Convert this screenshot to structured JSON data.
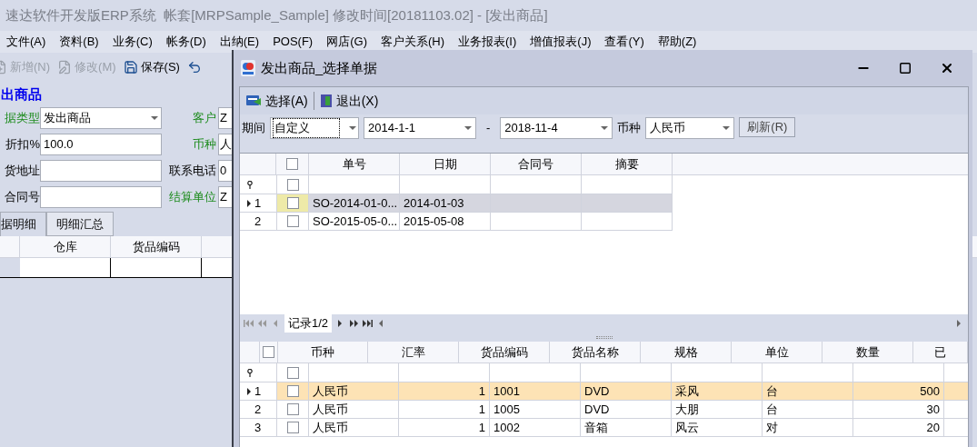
{
  "main_window": {
    "title": "速达软件开发版ERP系统  帐套[MRPSample_Sample] 修改时间[20181103.02] - [发出商品]",
    "menu": [
      "文件(A)",
      "资料(B)",
      "业务(C)",
      "帐务(D)",
      "出纳(E)",
      "POS(F)",
      "网店(G)",
      "客户关系(H)",
      "业务报表(I)",
      "增值报表(J)",
      "查看(Y)",
      "帮助(Z)"
    ],
    "toolbar": [
      {
        "kind": "new",
        "label": "新增(N)",
        "disabled": true
      },
      {
        "kind": "edit",
        "label": "修改(M)",
        "disabled": true
      },
      {
        "kind": "save",
        "label": "保存(S)",
        "disabled": false
      },
      {
        "kind": "undo",
        "disabled": false
      }
    ],
    "form_title": "出商品",
    "left_fields": [
      {
        "label": "据类型",
        "value": "发出商品",
        "required": true,
        "kind": "dropdown"
      },
      {
        "label": "折扣%",
        "value": "100.0",
        "required": false,
        "kind": "text"
      },
      {
        "label": "货地址",
        "required": false,
        "kind": "text"
      },
      {
        "label": "合同号",
        "required": false,
        "kind": "text"
      }
    ],
    "right_fields": [
      {
        "label": "客户",
        "value": "Z",
        "required": true
      },
      {
        "label": "币种",
        "value": "人",
        "required": true
      },
      {
        "label": "联系电话",
        "value": "0",
        "required": false
      },
      {
        "label": "结算单位",
        "value": "Z",
        "required": true
      }
    ],
    "tabs": [
      {
        "label": "据明细",
        "selected": true
      },
      {
        "label": "明细汇总",
        "selected": false
      }
    ],
    "grid_columns": [
      "仓库",
      "货品编码"
    ]
  },
  "dialog": {
    "title": "发出商品_选择单据",
    "toolbar": [
      {
        "kind": "select",
        "label": "选择(A)"
      },
      {
        "kind": "exit",
        "label": "退出(X)"
      }
    ],
    "filter": {
      "period_label": "期间",
      "period": "自定义",
      "from": "2014-1-1",
      "separator": "-",
      "to": "2018-11-4",
      "currency_label": "币种",
      "currency": "人民币",
      "refresh": "刷新(R)"
    },
    "orders": {
      "header_checked": false,
      "filter_checked": false,
      "columns": [
        "单号",
        "日期",
        "合同号",
        "摘要"
      ],
      "rows": [
        {
          "number": "1",
          "cells": [
            "SO-2014-01-0...",
            "2014-01-03"
          ],
          "selected": true,
          "checked": false
        },
        {
          "number": "2",
          "cells": [
            "SO-2015-05-0...",
            "2015-05-08"
          ],
          "selected": false,
          "checked": false
        }
      ]
    },
    "navigator": "记录1/2",
    "details": {
      "header_checked": false,
      "filter_checked": false,
      "columns": [
        "币种",
        "汇率",
        "货品编码",
        "货品名称",
        "规格",
        "单位",
        "数量",
        "已"
      ],
      "rows": [
        {
          "number": "1",
          "cells": [
            "人民币",
            "1",
            "1001",
            "DVD",
            "采风",
            "台",
            "500"
          ],
          "selected": true,
          "checked": false
        },
        {
          "number": "2",
          "cells": [
            "人民币",
            "1",
            "1005",
            "DVD",
            "大朋",
            "台",
            "30"
          ],
          "selected": false,
          "checked": false
        },
        {
          "number": "3",
          "cells": [
            "人民币",
            "1",
            "1002",
            "音箱",
            "风云",
            "对",
            "20"
          ],
          "selected": false,
          "checked": false
        }
      ]
    }
  }
}
